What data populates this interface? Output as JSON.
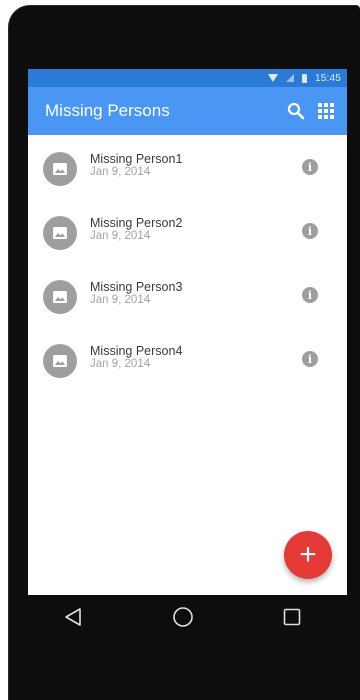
{
  "status_bar": {
    "time": "15:45"
  },
  "app_bar": {
    "title": "Missing Persons"
  },
  "list": [
    {
      "name": "Missing Person1",
      "date": "Jan 9, 2014",
      "info_label": "i"
    },
    {
      "name": "Missing Person2",
      "date": "Jan 9, 2014",
      "info_label": "i"
    },
    {
      "name": "Missing Person3",
      "date": "Jan 9, 2014",
      "info_label": "i"
    },
    {
      "name": "Missing Person4",
      "date": "Jan 9, 2014",
      "info_label": "i"
    }
  ],
  "fab": {
    "label": "+"
  },
  "colors": {
    "primary": "#4a97f3",
    "status_bar": "#2b7bd6",
    "accent": "#e53935",
    "avatar": "#9e9e9e"
  },
  "icons": {
    "search": "search-icon",
    "grid": "apps-grid-icon",
    "avatar": "image-icon",
    "info": "info-icon",
    "back": "back-triangle-icon",
    "home": "home-circle-icon",
    "recents": "recents-square-icon"
  }
}
